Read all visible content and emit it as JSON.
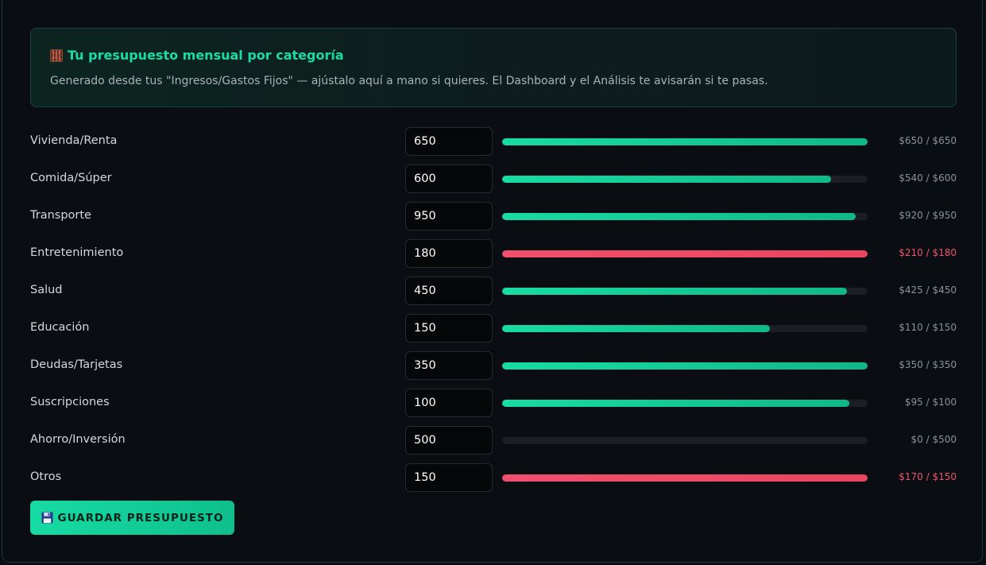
{
  "banner": {
    "title": "Tu presupuesto mensual por categoría",
    "title_icon": "abacus-icon",
    "description": "Generado desde tus \"Ingresos/Gastos Fijos\" — ajústalo aquí a mano si quieres. El Dashboard y el Análisis te avisarán si te pasas."
  },
  "colors": {
    "accent": "#19dca4",
    "over_budget": "#f0506e",
    "track": "#1b1f25"
  },
  "categories": [
    {
      "label": "Vivienda/Renta",
      "budget": "650",
      "spent_text": "$650 / $650",
      "spent": 650,
      "limit": 650,
      "over": false
    },
    {
      "label": "Comida/Súper",
      "budget": "600",
      "spent_text": "$540 / $600",
      "spent": 540,
      "limit": 600,
      "over": false
    },
    {
      "label": "Transporte",
      "budget": "950",
      "spent_text": "$920 / $950",
      "spent": 920,
      "limit": 950,
      "over": false
    },
    {
      "label": "Entretenimiento",
      "budget": "180",
      "spent_text": "$210 / $180",
      "spent": 210,
      "limit": 180,
      "over": true
    },
    {
      "label": "Salud",
      "budget": "450",
      "spent_text": "$425 / $450",
      "spent": 425,
      "limit": 450,
      "over": false
    },
    {
      "label": "Educación",
      "budget": "150",
      "spent_text": "$110 / $150",
      "spent": 110,
      "limit": 150,
      "over": false
    },
    {
      "label": "Deudas/Tarjetas",
      "budget": "350",
      "spent_text": "$350 / $350",
      "spent": 350,
      "limit": 350,
      "over": false
    },
    {
      "label": "Suscripciones",
      "budget": "100",
      "spent_text": "$95 / $100",
      "spent": 95,
      "limit": 100,
      "over": false
    },
    {
      "label": "Ahorro/Inversión",
      "budget": "500",
      "spent_text": "$0 / $500",
      "spent": 0,
      "limit": 500,
      "over": false
    },
    {
      "label": "Otros",
      "budget": "150",
      "spent_text": "$170 / $150",
      "spent": 170,
      "limit": 150,
      "over": true
    }
  ],
  "save_button": {
    "label": "GUARDAR PRESUPUESTO",
    "icon": "floppy-disk-icon"
  }
}
